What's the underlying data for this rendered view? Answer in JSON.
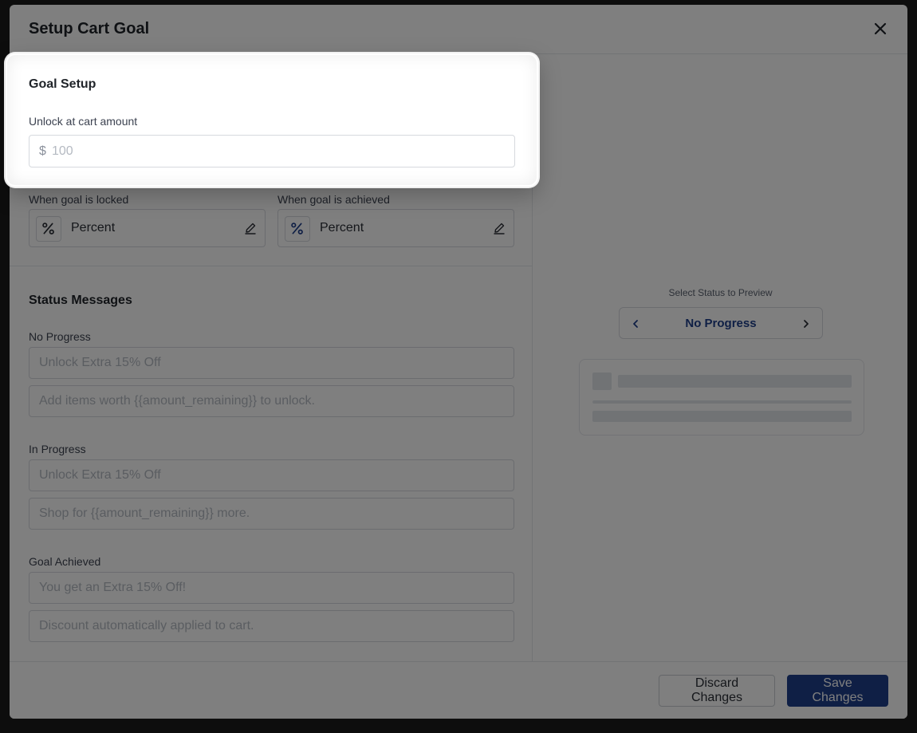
{
  "modal": {
    "title": "Setup Cart Goal"
  },
  "goal_setup": {
    "title": "Goal Setup",
    "unlock_label": "Unlock at cart amount",
    "currency_symbol": "$",
    "amount_placeholder": "100"
  },
  "icons_setup": {
    "locked_label": "When goal is locked",
    "locked_value": "Percent",
    "achieved_label": "When goal is achieved",
    "achieved_value": "Percent"
  },
  "status_messages": {
    "title": "Status Messages",
    "no_progress": {
      "label": "No Progress",
      "title_placeholder": "Unlock Extra 15% Off",
      "subtitle_placeholder": "Add items worth {{amount_remaining}} to unlock."
    },
    "in_progress": {
      "label": "In Progress",
      "title_placeholder": "Unlock Extra 15% Off",
      "subtitle_placeholder": "Shop for {{amount_remaining}} more."
    },
    "goal_achieved": {
      "label": "Goal Achieved",
      "title_placeholder": "You get an Extra 15% Off!",
      "subtitle_placeholder": "Discount automatically applied to cart."
    }
  },
  "preview": {
    "select_label": "Select Status to Preview",
    "current_status": "No Progress"
  },
  "footer": {
    "discard_label": "Discard Changes",
    "save_label": "Save Changes"
  },
  "colors": {
    "primary": "#1e3f8a",
    "border": "#d6d9de",
    "overlay": "rgba(0,0,0,0.5)"
  }
}
